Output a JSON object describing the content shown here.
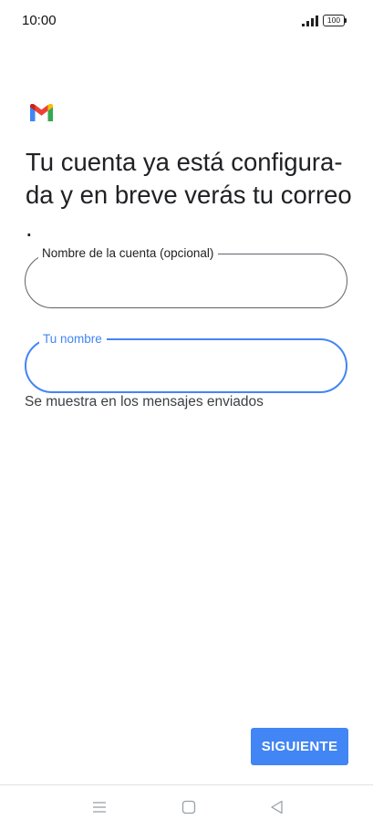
{
  "status_bar": {
    "time": "10:00",
    "battery": "100",
    "icons": [
      "signal-icon",
      "battery-icon"
    ]
  },
  "logo": {
    "icon": "gmail-logo-icon"
  },
  "headline": "Tu cuenta ya está configura-\nda y en breve verás tu correo\n.",
  "form": {
    "account_name": {
      "label": "Nombre de la cuenta (opcional)",
      "value": ""
    },
    "your_name": {
      "label": "Tu nombre",
      "value": "",
      "helper": "Se muestra en los mensajes enviados"
    }
  },
  "actions": {
    "next_label": "SIGUIENTE"
  },
  "colors": {
    "accent": "#4285f4",
    "text": "#202124",
    "outline": "#5f6368"
  },
  "nav_bar": {
    "icons": [
      "menu-icon",
      "home-icon",
      "back-icon"
    ]
  }
}
